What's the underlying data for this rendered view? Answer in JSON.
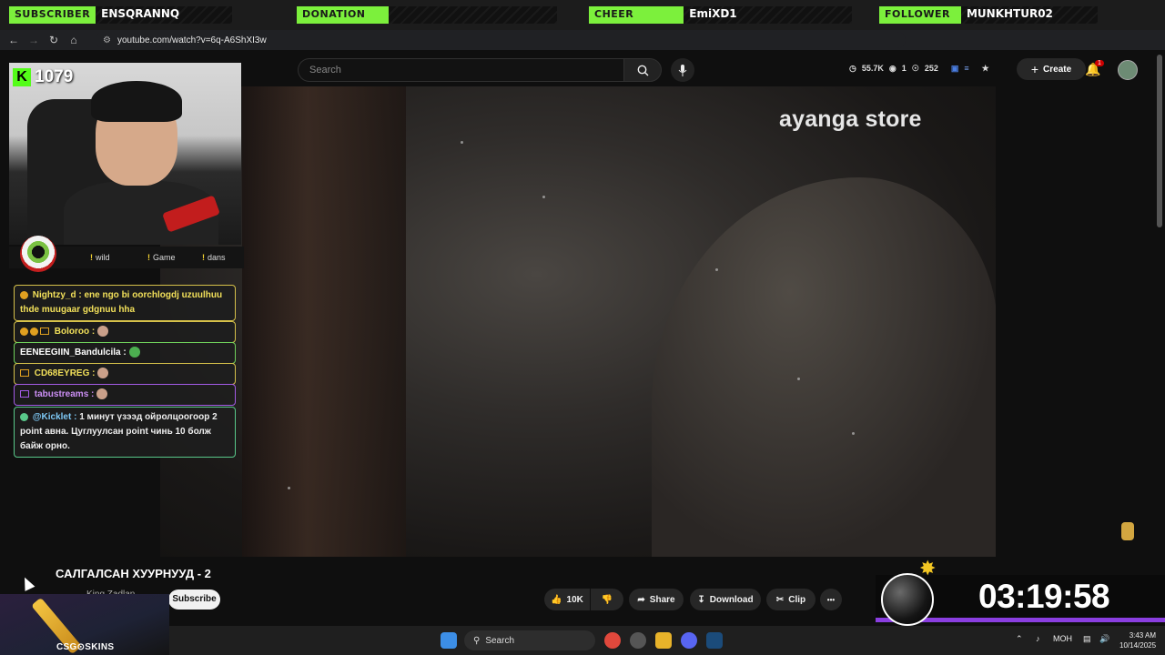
{
  "alerts": [
    {
      "tag": "SUBSCRIBER",
      "name": "ENSQRANNQ"
    },
    {
      "tag": "DONATION",
      "name": ""
    },
    {
      "tag": "CHEER",
      "name": "EmiXD1"
    },
    {
      "tag": "FOLLOWER",
      "name": "MUNKHTUR02"
    }
  ],
  "browser": {
    "url": "youtube.com/watch?v=6q-A6ShXI3w"
  },
  "youtube": {
    "search_placeholder": "Search",
    "stats": {
      "viewers": "55.7K",
      "one": "1",
      "likes": "252"
    },
    "create_label": "Create",
    "notif_count": "1",
    "video_title": "САЛГАЛСАН ХУУРНУУД - 2",
    "channel": "King Zadlan",
    "subscribe_label": "Subscribe",
    "likes": "10K",
    "share_label": "Share",
    "download_label": "Download",
    "clip_label": "Clip",
    "more_label": "•••"
  },
  "overlay": {
    "watermark": "ayanga store",
    "kick_icon": "K",
    "kick_count": "1079",
    "commands": [
      {
        "bang": "!",
        "label": "wild"
      },
      {
        "bang": "!",
        "label": "Game"
      },
      {
        "bang": "!",
        "label": "dans"
      }
    ],
    "chat": [
      {
        "user": "Nightzy_d :",
        "text": "ene ngo bi oorchlogdj uzuulhuu thde muugaar gdgnuu hha"
      },
      {
        "user": "Boloroo :",
        "text": ""
      },
      {
        "user": "EENEEGIIN_Bandulcila :",
        "text": ""
      },
      {
        "user": "CD68EYREG :",
        "text": ""
      },
      {
        "user": "tabustreams :",
        "text": ""
      },
      {
        "user": "@Kicklet :",
        "text": "1 минут үзээд ойролцоогоор 2 point авна. Цуглуулсан point чинь 10 болж байж орно."
      }
    ],
    "timer": "03:19:58",
    "sponsor": "CSG⊙SKINS"
  },
  "taskbar": {
    "search_label": "Search",
    "lang": "МОН",
    "time": "3:43 AM",
    "date": "10/14/2025"
  },
  "colors": {
    "alert_green": "#7cf03c",
    "kick_green": "#53fc18",
    "timer_bar": "#8a3ee0",
    "chat_gold": "#d6c14a"
  }
}
